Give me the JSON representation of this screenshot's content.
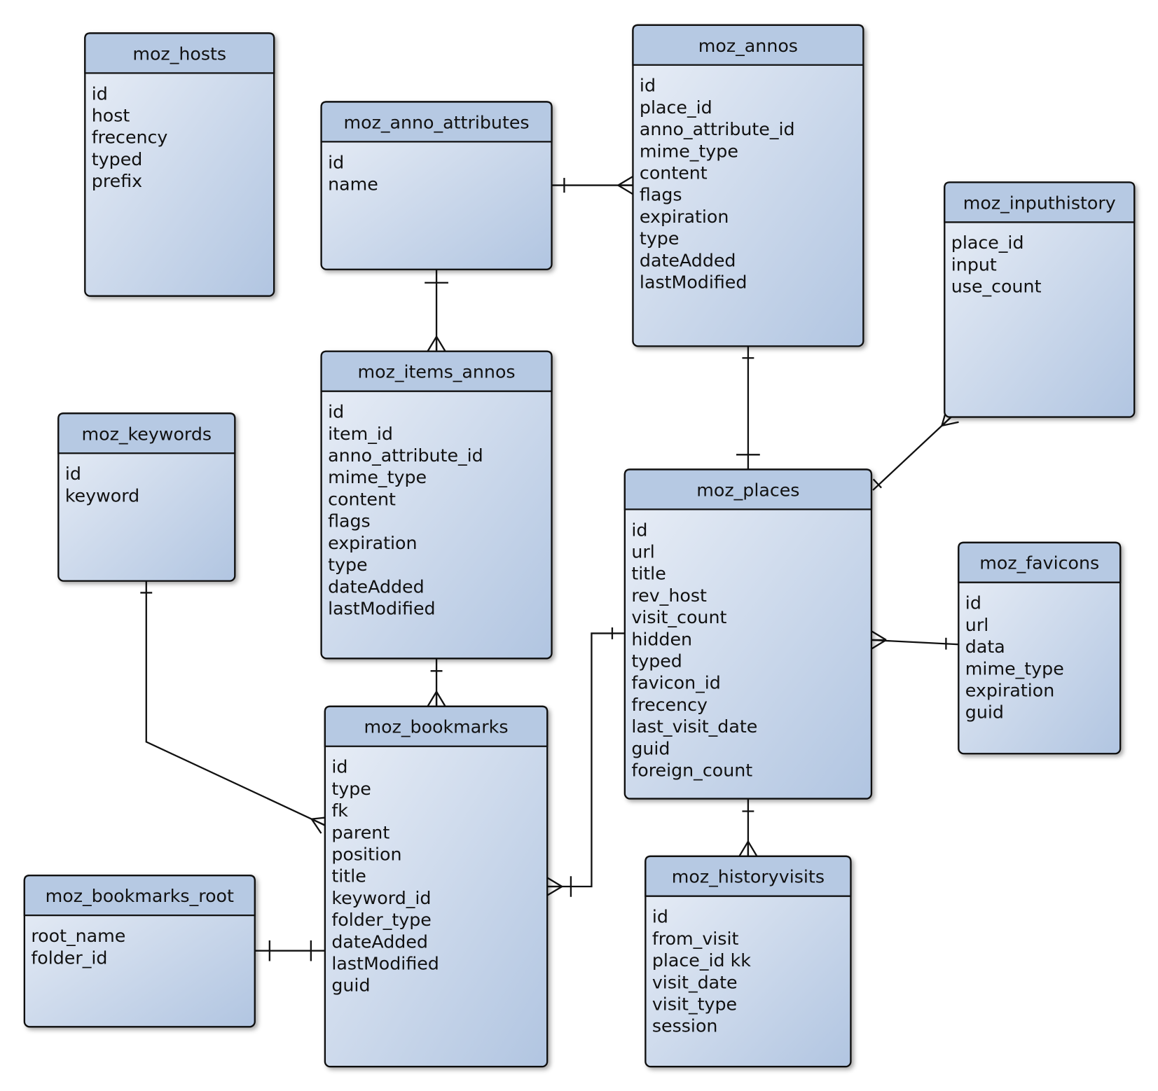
{
  "colors": {
    "header": "#b6c9e3",
    "body_light": "#e8edf6",
    "body_dark": "#b3c6e2",
    "border": "#111111"
  },
  "tables": [
    {
      "name": "moz_hosts",
      "fields": [
        "id",
        "host",
        "frecency",
        "typed",
        "prefix"
      ]
    },
    {
      "name": "moz_anno_attributes",
      "fields": [
        "id",
        "name"
      ]
    },
    {
      "name": "moz_annos",
      "fields": [
        "id",
        "place_id",
        "anno_attribute_id",
        "mime_type",
        "content",
        "flags",
        "expiration",
        "type",
        "dateAdded",
        "lastModified"
      ]
    },
    {
      "name": "moz_inputhistory",
      "fields": [
        "place_id",
        "input",
        "use_count"
      ]
    },
    {
      "name": "moz_items_annos",
      "fields": [
        "id",
        "item_id",
        "anno_attribute_id",
        "mime_type",
        "content",
        "flags",
        "expiration",
        "type",
        "dateAdded",
        "lastModified"
      ]
    },
    {
      "name": "moz_keywords",
      "fields": [
        "id",
        "keyword"
      ]
    },
    {
      "name": "moz_places",
      "fields": [
        "id",
        "url",
        "title",
        "rev_host",
        "visit_count",
        "hidden",
        "typed",
        "favicon_id",
        "frecency",
        "last_visit_date",
        "guid",
        "foreign_count"
      ]
    },
    {
      "name": "moz_favicons",
      "fields": [
        "id",
        "url",
        "data",
        "mime_type",
        "expiration",
        "guid"
      ]
    },
    {
      "name": "moz_bookmarks",
      "fields": [
        "id",
        "type",
        "fk",
        "parent",
        "position",
        "title",
        "keyword_id",
        "folder_type",
        "dateAdded",
        "lastModified",
        "guid"
      ]
    },
    {
      "name": "moz_bookmarks_root",
      "fields": [
        "root_name",
        "folder_id"
      ]
    },
    {
      "name": "moz_historyvisits",
      "fields": [
        "id",
        "from_visit",
        "place_id  kk",
        "visit_date",
        "visit_type",
        "session"
      ]
    }
  ],
  "relationships": [
    {
      "from": "moz_anno_attributes",
      "to": "moz_annos",
      "from_card": "one",
      "to_card": "many"
    },
    {
      "from": "moz_anno_attributes",
      "to": "moz_items_annos",
      "from_card": "one-and-only-one",
      "to_card": "many"
    },
    {
      "from": "moz_places",
      "to": "moz_annos",
      "from_card": "one-and-only-one",
      "to_card": "one"
    },
    {
      "from": "moz_places",
      "to": "moz_inputhistory",
      "from_card": "one",
      "to_card": "many"
    },
    {
      "from": "moz_favicons",
      "to": "moz_places",
      "from_card": "one",
      "to_card": "many"
    },
    {
      "from": "moz_places",
      "to": "moz_historyvisits",
      "from_card": "one",
      "to_card": "many"
    },
    {
      "from": "moz_items_annos",
      "to": "moz_bookmarks",
      "from_card": "one",
      "to_card": "many"
    },
    {
      "from": "moz_keywords",
      "to": "moz_bookmarks",
      "from_card": "one",
      "to_card": "many"
    },
    {
      "from": "moz_places",
      "to": "moz_bookmarks",
      "from_card": "one",
      "to_card": "one-or-many"
    },
    {
      "from": "moz_bookmarks_root",
      "to": "moz_bookmarks",
      "from_card": "one",
      "to_card": "one"
    }
  ]
}
